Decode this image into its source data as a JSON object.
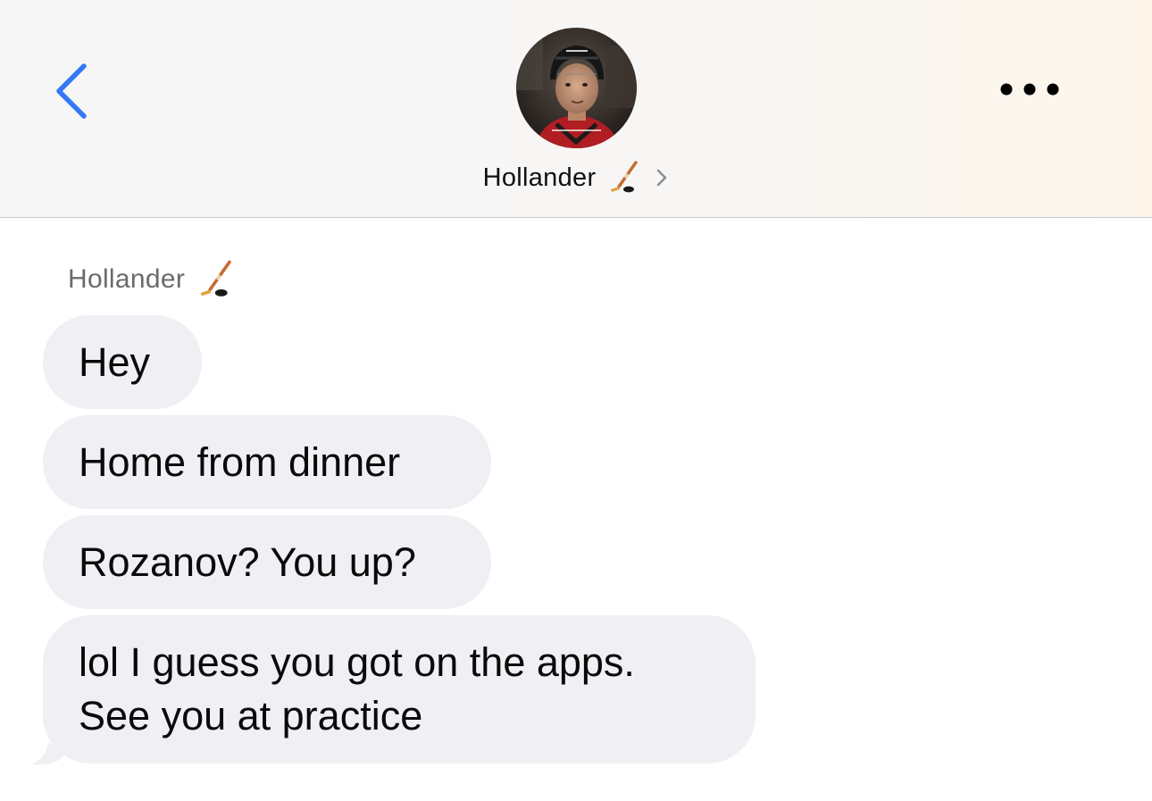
{
  "header": {
    "contact_name": "Hollander",
    "contact_emoji": "ice-hockey-emoji",
    "back_icon": "chevron-left-icon",
    "more_icon": "ellipsis-icon",
    "accent_color": "#3478f6"
  },
  "thread": {
    "sender_name": "Hollander",
    "bubble_color": "#efeff4",
    "messages": [
      {
        "lines": [
          "Hey"
        ]
      },
      {
        "lines": [
          "Home from dinner"
        ]
      },
      {
        "lines": [
          "Rozanov? You up?"
        ]
      },
      {
        "lines": [
          "lol I guess you got on the apps.",
          "See you at practice"
        ]
      }
    ]
  }
}
